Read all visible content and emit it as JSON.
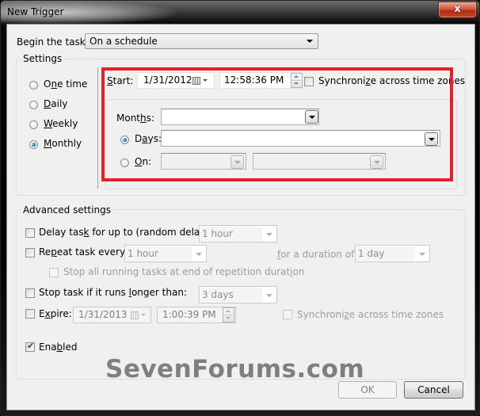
{
  "window": {
    "title": "New Trigger",
    "close_glyph": "x"
  },
  "begin_task": {
    "label_pre": "Begin the task:",
    "value": "On a schedule"
  },
  "settings": {
    "group_title": "Settings",
    "schedule_options": [
      {
        "pre": "O",
        "ul": "n",
        "post": "e time",
        "selected": false
      },
      {
        "pre": "",
        "ul": "D",
        "post": "aily",
        "selected": false
      },
      {
        "pre": "",
        "ul": "W",
        "post": "eekly",
        "selected": false
      },
      {
        "pre": "",
        "ul": "M",
        "post": "onthly",
        "selected": true
      }
    ],
    "start": {
      "label_ul": "S",
      "label_post": "tart:",
      "date": "1/31/2012",
      "time": "12:58:36 PM"
    },
    "sync_timezones": {
      "pre": "Synchroni",
      "ul": "z",
      "post": "e across time zones",
      "checked": false
    },
    "monthly": {
      "months_label_pre": "Mont",
      "months_label_ul": "h",
      "months_label_post": "s:",
      "months_value": "",
      "days_label_pre": "D",
      "days_label_ul": "a",
      "days_label_post": "ys:",
      "days_selected": true,
      "days_value": "",
      "on_label_ul": "O",
      "on_label_post": "n:",
      "on_selected": false,
      "on_week_value": "",
      "on_day_value": ""
    }
  },
  "advanced": {
    "group_title": "Advanced settings",
    "delay": {
      "pre": "Delay tas",
      "ul": "k",
      "post": " for up to (random delay):",
      "checked": false,
      "value": "1 hour"
    },
    "repeat": {
      "pre": "Re",
      "ul": "p",
      "post": "eat task every:",
      "checked": false,
      "value": "1 hour",
      "duration_label_ul": "f",
      "duration_label_post": "or a duration of:",
      "duration_value": "1 day"
    },
    "stop_all": {
      "pre": "Stop all running tasks at end of repetition durat",
      "ul": "i",
      "post": "on",
      "checked": false
    },
    "stop_if": {
      "pre": "Stop task if it runs ",
      "ul": "l",
      "post": "onger than:",
      "checked": false,
      "value": "3 days"
    },
    "expire": {
      "pre": "E",
      "ul": "x",
      "post": "pire:",
      "checked": false,
      "date": "1/31/2013",
      "time": "1:00:39 PM"
    },
    "expire_sync": {
      "pre": "Synchroni",
      "ul": "z",
      "post": "e across time zones",
      "checked": false
    },
    "enabled": {
      "pre": "Ena",
      "ul": "b",
      "post": "led",
      "checked": true
    }
  },
  "footer": {
    "ok_label": "OK",
    "cancel_label": "Cancel"
  },
  "watermark": "SevenForums.com",
  "colors": {
    "highlight_box": "#e3212a",
    "dialog_bg": "#f0f0f0"
  }
}
